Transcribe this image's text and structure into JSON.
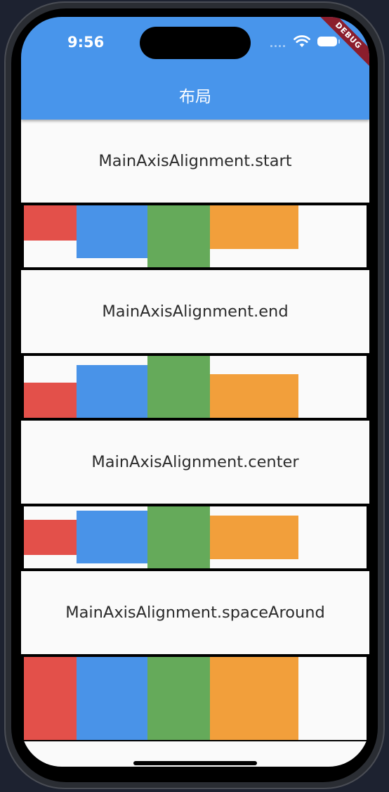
{
  "status_bar": {
    "time": "9:56",
    "debug_banner": "DEBUG"
  },
  "app_bar": {
    "title": "布局",
    "color": "#4895eb"
  },
  "sections": [
    {
      "label": "MainAxisAlignment.start"
    },
    {
      "label": "MainAxisAlignment.end"
    },
    {
      "label": "MainAxisAlignment.center"
    },
    {
      "label": "MainAxisAlignment.spaceAround"
    }
  ],
  "block_colors": {
    "red": "#e3504a",
    "blue": "#4993e8",
    "green": "#65aa5a",
    "orange": "#f29f3b"
  }
}
